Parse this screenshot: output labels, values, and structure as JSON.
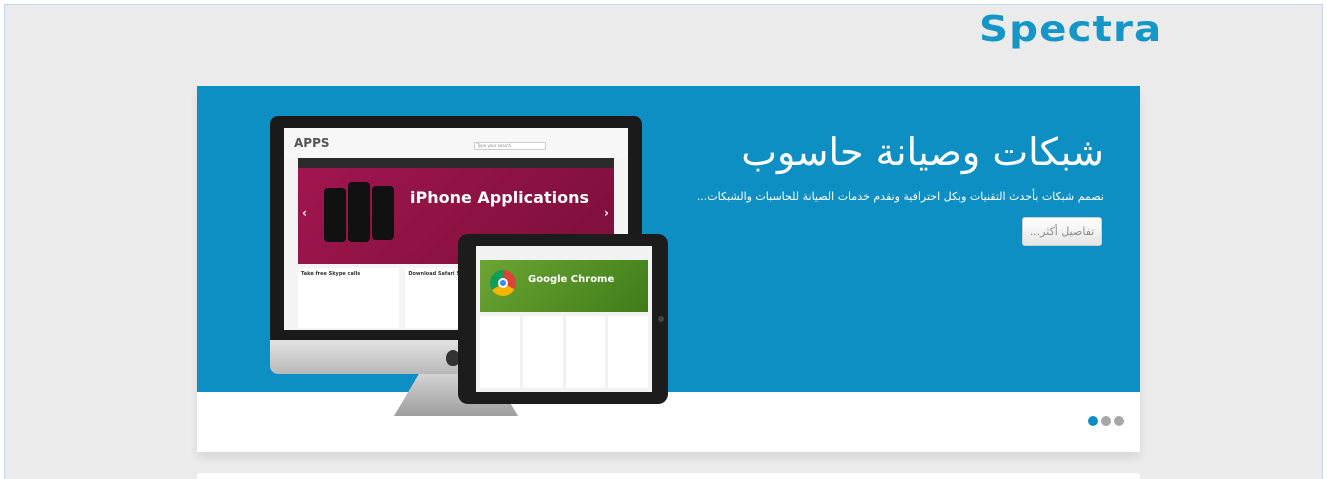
{
  "brand": {
    "logo_text": "Spectra",
    "accent_color": "#1497c6"
  },
  "slider": {
    "headline": "شبكات وصيانة حاسوب",
    "subline": "نصمم شبكات بأحدث التقنيات وبكل احترافية ونقدم خدمات الصيانة للحاسبات والشبكات...",
    "more_button_label": "تفاصيل أكثر...",
    "background_color": "#0d8fc4",
    "dots": [
      {
        "name": "slide-1",
        "active": true
      },
      {
        "name": "slide-2",
        "active": false
      },
      {
        "name": "slide-3",
        "active": false
      }
    ]
  },
  "illustration": {
    "imac_screen": {
      "logo": "APPS",
      "search_placeholder": "Type your search",
      "banner_title": "iPhone Applications",
      "columns": [
        "Take free Skype calls",
        "Download Safari 5"
      ]
    },
    "ipad_screen": {
      "banner_title": "Google Chrome"
    }
  }
}
